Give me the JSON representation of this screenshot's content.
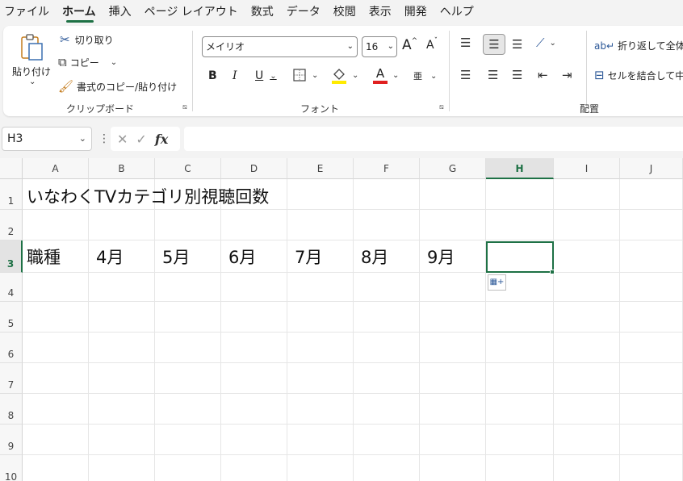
{
  "menu": {
    "items": [
      {
        "label": "ファイル"
      },
      {
        "label": "ホーム"
      },
      {
        "label": "挿入"
      },
      {
        "label": "ページ レイアウト"
      },
      {
        "label": "数式"
      },
      {
        "label": "データ"
      },
      {
        "label": "校閲"
      },
      {
        "label": "表示"
      },
      {
        "label": "開発"
      },
      {
        "label": "ヘルプ"
      }
    ],
    "active": "ホーム"
  },
  "clipboard": {
    "paste_label": "貼り付け",
    "cut_label": "切り取り",
    "copy_label": "コピー",
    "format_painter_label": "書式のコピー/貼り付け",
    "group_label": "クリップボード"
  },
  "font": {
    "font_name": "メイリオ",
    "font_size": "16",
    "grow_label": "A",
    "shrink_label": "A",
    "bold_label": "B",
    "italic_label": "I",
    "underline_label": "U",
    "font_color_label": "A",
    "phonetic_label": "亜",
    "group_label": "フォント"
  },
  "alignment": {
    "wrap_text_label": "折り返して全体を",
    "merge_label": "セルを結合して中",
    "group_label": "配置"
  },
  "formula_bar": {
    "name_box": "H3",
    "fx_label": "fx",
    "formula": ""
  },
  "sheet": {
    "columns": [
      "A",
      "B",
      "C",
      "D",
      "E",
      "F",
      "G",
      "H",
      "I",
      "J"
    ],
    "rows": [
      "1",
      "2",
      "3",
      "4",
      "5",
      "6",
      "7",
      "8",
      "9",
      "10"
    ],
    "selected_column": "H",
    "selected_row": "3",
    "cells": {
      "A1": "いなわくTVカテゴリ別視聴回数",
      "A3": "職種",
      "B3": "4月",
      "C3": "5月",
      "D3": "6月",
      "E3": "7月",
      "F3": "8月",
      "G3": "9月"
    }
  },
  "colors": {
    "accent": "#1e7145",
    "ribbon_bg": "#f3f3f3",
    "highlight_yellow": "#ffeb00",
    "font_red": "#e02020"
  }
}
